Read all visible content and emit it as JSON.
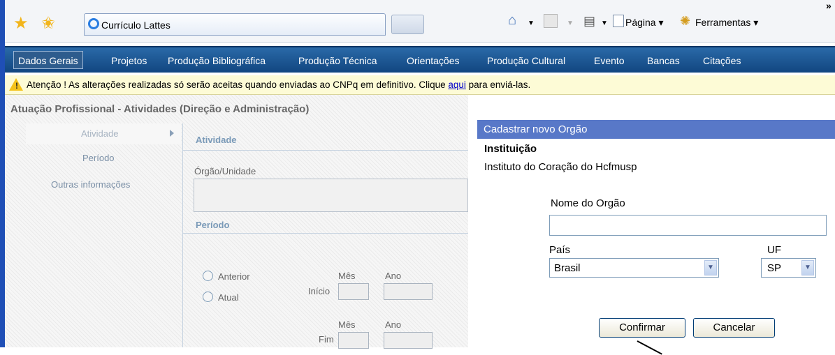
{
  "browser": {
    "tab_title": "Currículo Lattes",
    "toolbar": {
      "page_label": "Página",
      "tools_label": "Ferramentas",
      "more_label": "»"
    }
  },
  "nav": {
    "items": [
      {
        "label": "Dados Gerais"
      },
      {
        "label": "Projetos"
      },
      {
        "label": "Produção Bibliográfica"
      },
      {
        "label": "Produção Técnica"
      },
      {
        "label": "Orientações"
      },
      {
        "label": "Produção Cultural"
      },
      {
        "label": "Evento"
      },
      {
        "label": "Bancas"
      },
      {
        "label": "Citações"
      }
    ],
    "active_index": 0
  },
  "warning": {
    "prefix": "Atenção ! As alterações realizadas só serão aceitas quando enviadas ao CNPq em definitivo. Clique ",
    "link": "aqui",
    "suffix": " para enviá-las."
  },
  "form": {
    "section_title": "Atuação Profissional - Atividades (Direção e Administração)",
    "menu": [
      "Atividade",
      "Período",
      "Outras informações"
    ],
    "atividade_heading": "Atividade",
    "orgao_label": "Órgão/Unidade",
    "periodo_heading": "Período",
    "radio_anterior": "Anterior",
    "radio_atual": "Atual",
    "mes_label": "Mês",
    "ano_label": "Ano",
    "inicio_label": "Início",
    "fim_label": "Fim"
  },
  "dialog": {
    "header": "Cadastrar novo Orgão",
    "institution_label": "Instituição",
    "institution_value": "Instituto do Coração do Hcfmusp",
    "name_label": "Nome do Orgão",
    "name_value": "",
    "country_label": "País",
    "country_value": "Brasil",
    "uf_label": "UF",
    "uf_value": "SP",
    "confirm_label": "Confirmar",
    "cancel_label": "Cancelar"
  }
}
